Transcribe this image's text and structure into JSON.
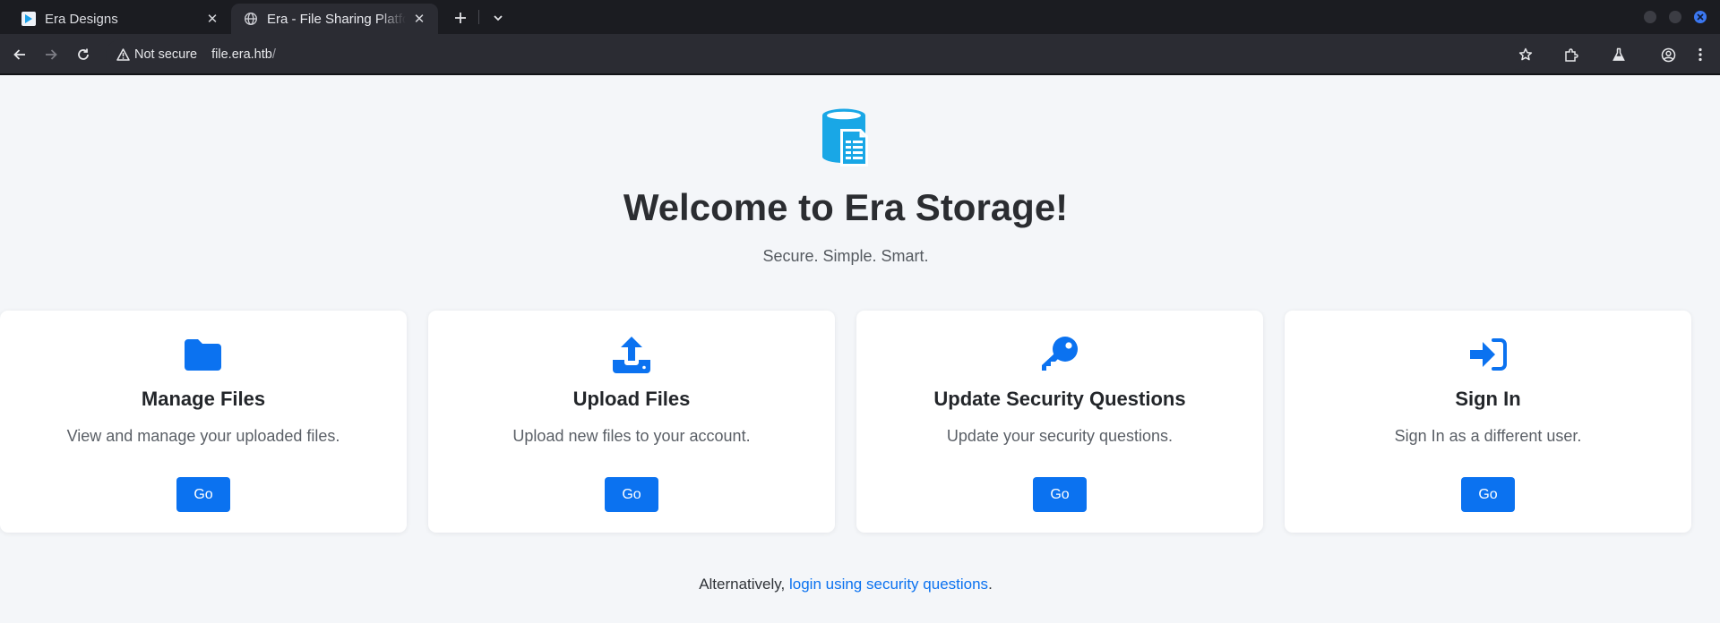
{
  "browser": {
    "tabs": [
      {
        "title": "Era Designs",
        "active": false,
        "favicon": "play-favicon"
      },
      {
        "title": "Era - File Sharing Platform",
        "active": true,
        "favicon": "globe-favicon"
      }
    ],
    "security_label": "Not secure",
    "url_host": "file.era.htb",
    "url_path": "/"
  },
  "page": {
    "title": "Welcome to Era Storage!",
    "subtitle": "Secure. Simple. Smart.",
    "cards": [
      {
        "icon": "folder-icon",
        "title": "Manage Files",
        "description": "View and manage your uploaded files.",
        "button": "Go"
      },
      {
        "icon": "upload-icon",
        "title": "Upload Files",
        "description": "Upload new files to your account.",
        "button": "Go"
      },
      {
        "icon": "key-icon",
        "title": "Update Security Questions",
        "description": "Update your security questions.",
        "button": "Go"
      },
      {
        "icon": "sign-in-icon",
        "title": "Sign In",
        "description": "Sign In as a different user.",
        "button": "Go"
      }
    ],
    "footer": {
      "prefix": "Alternatively,",
      "link_text": "login using security questions",
      "suffix": "."
    }
  },
  "colors": {
    "accent": "#0b72f0",
    "logo": "#19a7e6",
    "background": "#f4f6f9"
  }
}
